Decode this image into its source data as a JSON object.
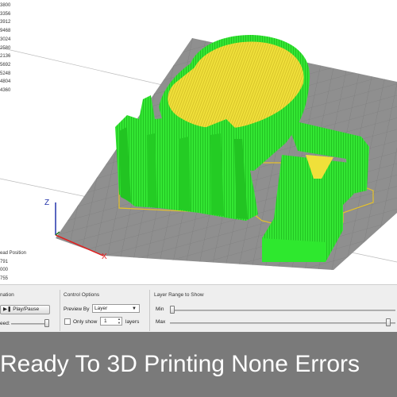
{
  "stats": {
    "lines": [
      "3800",
      "3356",
      "3912",
      "9468",
      "3024",
      "2580",
      "2136",
      "5692",
      "5248",
      "4804",
      "4360"
    ]
  },
  "head_position": {
    "title": "ead Position",
    "values": [
      "791",
      "000",
      "755"
    ]
  },
  "controls": {
    "animation": {
      "label": "nation",
      "play_pause_label": "Play/Pause",
      "speed_label": "eed:",
      "speed_level": 1.0
    },
    "control_options": {
      "label": "Control Options",
      "preview_by_label": "Preview By",
      "preview_by_value": "Layer",
      "only_show_label": "Only show",
      "only_show_checked": false,
      "only_show_value": "1",
      "layers_label": "layers"
    },
    "layer_range": {
      "label": "Layer Range to Show",
      "min_label": "Min",
      "max_label": "Max",
      "min_level": 0.0,
      "max_level": 0.98
    }
  },
  "banner": {
    "text": "Ready To 3D Printing None Errors"
  },
  "colors": {
    "bed": "#8f8f8f",
    "model_green": "#2ee82e",
    "model_green_dark": "#1fb81f",
    "model_yellow": "#f2e23a",
    "axis_x": "#e02020",
    "axis_y": "#2a7a2a",
    "axis_z": "#2233aa",
    "banner_bg": "#7a7a7a"
  }
}
